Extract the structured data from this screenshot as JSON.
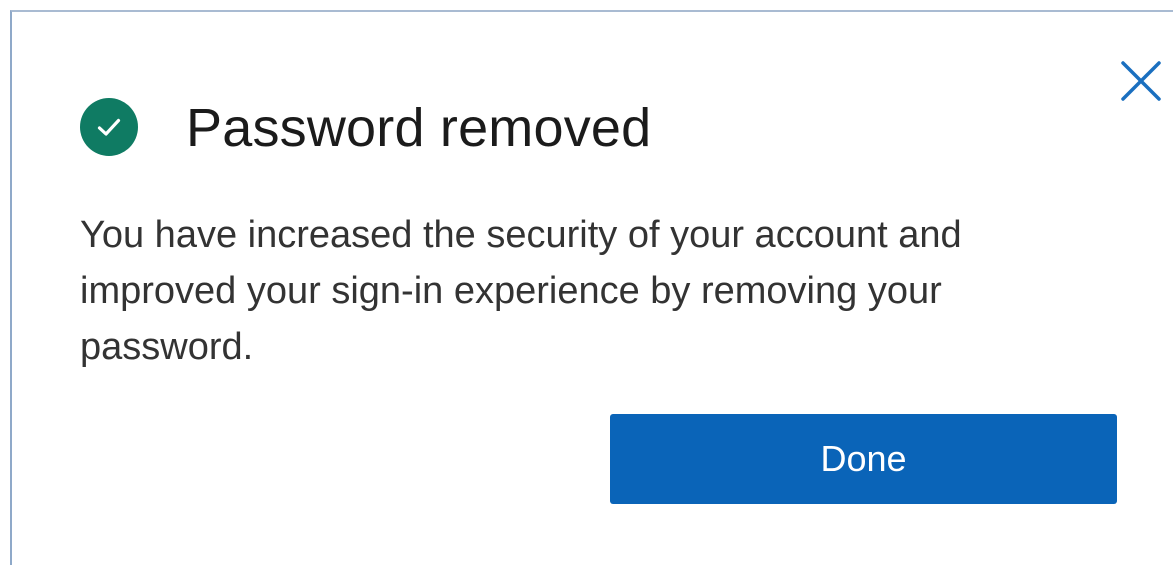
{
  "dialog": {
    "title": "Password removed",
    "message": "You have increased the security of your account and improved your sign-in experience by removing your password.",
    "done_label": "Done",
    "status_icon": "check-circle-icon",
    "close_icon": "close-icon"
  },
  "colors": {
    "accent": "#0a64b8",
    "success": "#0f7b63",
    "close": "#1a6fbf"
  }
}
